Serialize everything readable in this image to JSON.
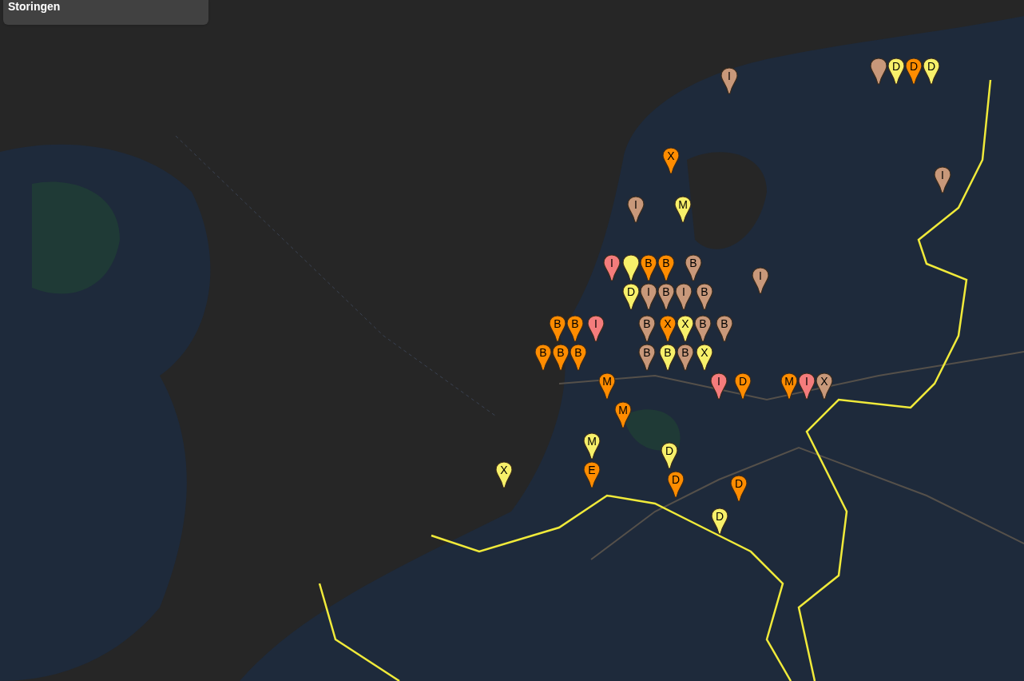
{
  "panel": {
    "title": "Storingen"
  },
  "markers": [
    {
      "color": "#c8987a"
    },
    {
      "letter": "D",
      "color": "#f7f06a"
    },
    {
      "letter": "D",
      "color": "#ff8c00"
    },
    {
      "letter": "D",
      "color": "#f7f06a"
    },
    {
      "letter": "I",
      "color": "#c8987a"
    },
    {
      "letter": "X",
      "color": "#ff8c00"
    },
    {
      "letter": "I",
      "color": "#c8987a"
    },
    {
      "letter": "I",
      "color": "#c8987a"
    },
    {
      "letter": "M",
      "color": "#f7f06a"
    },
    {
      "letter": "I",
      "color": "#f47c7c"
    },
    {
      "color": "#f7f06a"
    },
    {
      "letter": "B",
      "color": "#ff8c00"
    },
    {
      "letter": "B",
      "color": "#ff8c00"
    },
    {
      "letter": "B",
      "color": "#c8987a"
    },
    {
      "letter": "I",
      "color": "#c8987a"
    },
    {
      "letter": "D",
      "color": "#f7f06a"
    },
    {
      "letter": "I",
      "color": "#c8987a"
    },
    {
      "letter": "B",
      "color": "#c8987a"
    },
    {
      "letter": "I",
      "color": "#c8987a"
    },
    {
      "letter": "B",
      "color": "#c8987a"
    },
    {
      "letter": "B",
      "color": "#ff8c00"
    },
    {
      "letter": "B",
      "color": "#ff8c00"
    },
    {
      "letter": "I",
      "color": "#f47c7c"
    },
    {
      "letter": "B",
      "color": "#c8987a"
    },
    {
      "letter": "X",
      "color": "#ff8c00"
    },
    {
      "letter": "X",
      "color": "#f7f06a"
    },
    {
      "letter": "B",
      "color": "#c8987a"
    },
    {
      "letter": "B",
      "color": "#c8987a"
    },
    {
      "letter": "B",
      "color": "#ff8c00"
    },
    {
      "letter": "B",
      "color": "#ff8c00"
    },
    {
      "letter": "B",
      "color": "#ff8c00"
    },
    {
      "letter": "B",
      "color": "#c8987a"
    },
    {
      "letter": "B",
      "color": "#f7f06a"
    },
    {
      "letter": "B",
      "color": "#c8987a"
    },
    {
      "letter": "X",
      "color": "#f7f06a"
    },
    {
      "letter": "M",
      "color": "#ff8c00"
    },
    {
      "letter": "I",
      "color": "#f47c7c"
    },
    {
      "letter": "D",
      "color": "#ff8c00"
    },
    {
      "letter": "M",
      "color": "#ff8c00"
    },
    {
      "letter": "I",
      "color": "#f47c7c"
    },
    {
      "letter": "X",
      "color": "#c8987a"
    },
    {
      "letter": "M",
      "color": "#ff8c00"
    },
    {
      "letter": "M",
      "color": "#f7f06a"
    },
    {
      "letter": "D",
      "color": "#f7f06a"
    },
    {
      "letter": "X",
      "color": "#f7f06a"
    },
    {
      "letter": "E",
      "color": "#ff8c00"
    },
    {
      "letter": "D",
      "color": "#ff8c00"
    },
    {
      "letter": "D",
      "color": "#ff8c00"
    },
    {
      "letter": "D",
      "color": "#f7f06a"
    }
  ]
}
